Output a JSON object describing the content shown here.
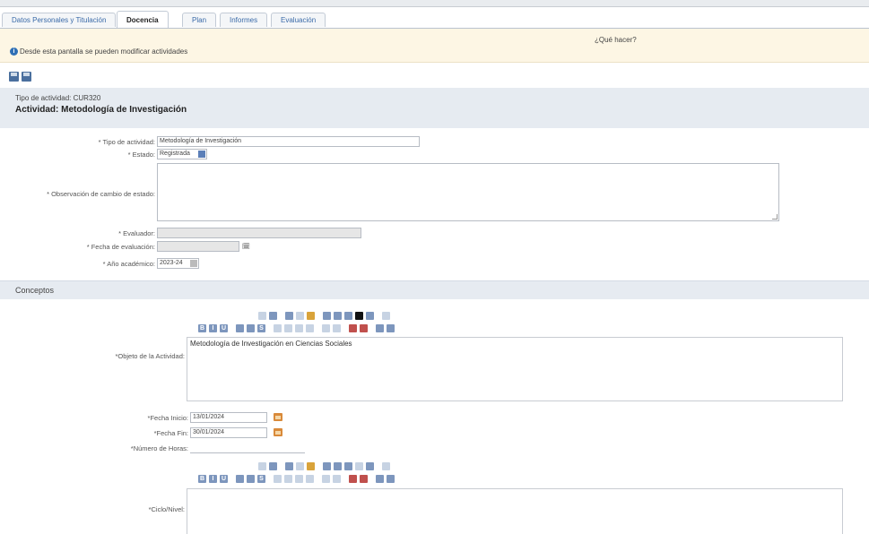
{
  "tabs": [
    {
      "label": "Datos Personales y Titulación",
      "active": false
    },
    {
      "label": "Docencia",
      "active": true
    },
    {
      "label": "Plan",
      "active": false
    },
    {
      "label": "Informes",
      "active": false
    },
    {
      "label": "Evaluación",
      "active": false
    }
  ],
  "help": {
    "what_to_do": "¿Qué hacer?",
    "info_text": "Desde esta pantalla se pueden modificar actividades"
  },
  "toolbar": {
    "save_icon": "save-icon",
    "save_close_icon": "save-close-icon"
  },
  "activity": {
    "type_line": "Tipo de actividad: CUR320",
    "title": "Actividad: Metodología de Investigación"
  },
  "form": {
    "tipo_label": "* Tipo de actividad:",
    "tipo_value": "Metodología de Investigación",
    "estado_label": "* Estado:",
    "estado_value": "Registrada",
    "observacion_label": "* Observación de cambio de estado:",
    "evaluador_label": "* Evaluador:",
    "fecha_eval_label": "* Fecha de evaluación:",
    "anio_label": "* Año académico:",
    "anio_value": "2023-24"
  },
  "conceptos": {
    "section_title": "Conceptos",
    "objeto_label": "*Objeto de la Actividad:",
    "objeto_value": "Metodología de Investigación en Ciencias Sociales",
    "fecha_inicio_label": "*Fecha Inicio:",
    "fecha_inicio_value": "13/01/2024",
    "fecha_fin_label": "*Fecha Fin:",
    "fecha_fin_value": "30/01/2024",
    "horas_label": "*Número de Horas:",
    "horas_value": "",
    "ciclo_label": "*Ciclo/Nivel:"
  }
}
